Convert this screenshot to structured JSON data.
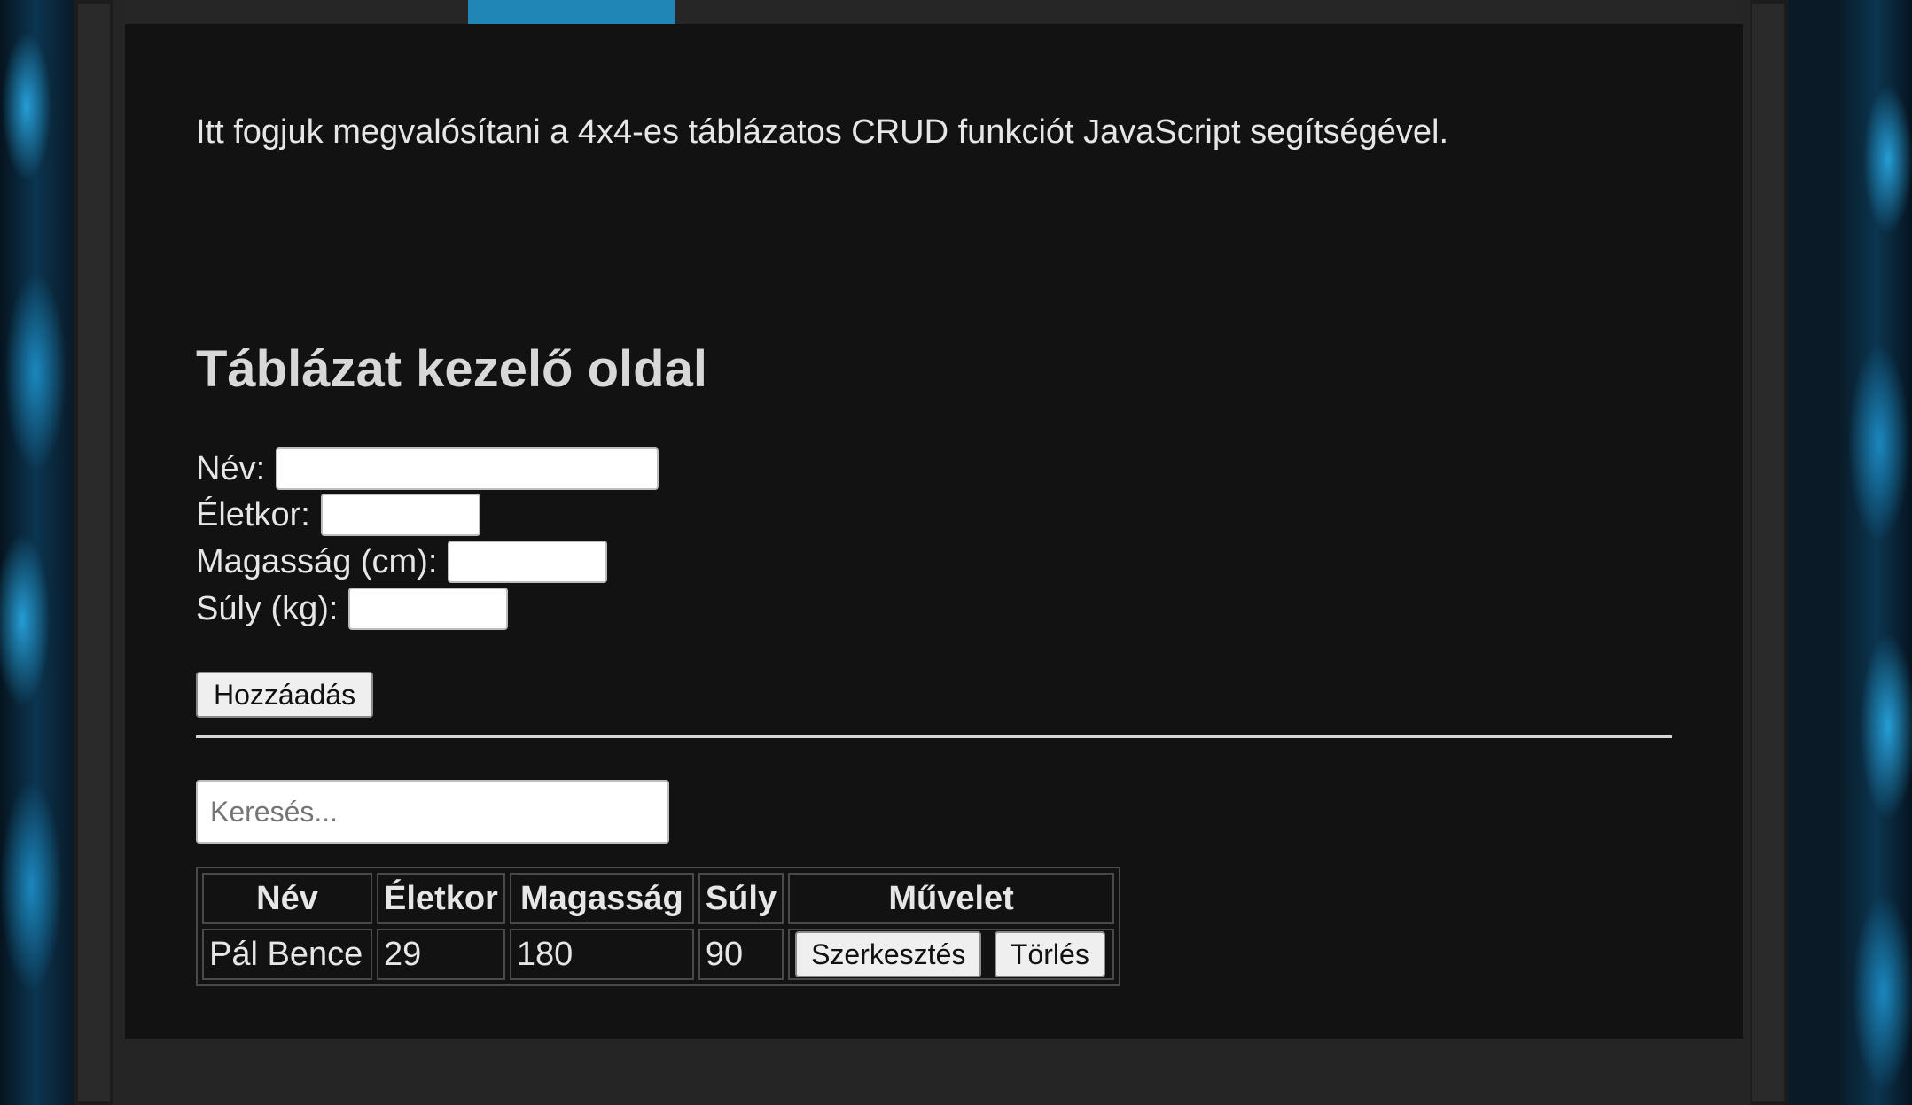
{
  "page": {
    "intro_text": "Itt fogjuk megvalósítani a 4x4-es táblázatos CRUD funkciót JavaScript segítségével.",
    "heading": "Táblázat kezelő oldal"
  },
  "form": {
    "name_label": "Név:",
    "age_label": "Életkor:",
    "height_label": "Magasság (cm):",
    "weight_label": "Súly (kg):",
    "name_value": "",
    "age_value": "",
    "height_value": "",
    "weight_value": "",
    "add_button": "Hozzáadás"
  },
  "search": {
    "placeholder": "Keresés...",
    "value": ""
  },
  "table": {
    "headers": [
      "Név",
      "Életkor",
      "Magasság",
      "Súly",
      "Művelet"
    ],
    "rows": [
      {
        "name": "Pál Bence",
        "age": "29",
        "height": "180",
        "weight": "90",
        "edit_label": "Szerkesztés",
        "delete_label": "Törlés"
      }
    ]
  },
  "theme": {
    "accent": "#1f86b5",
    "content_bg": "#121212",
    "frame_bg": "#2a2a2a"
  }
}
